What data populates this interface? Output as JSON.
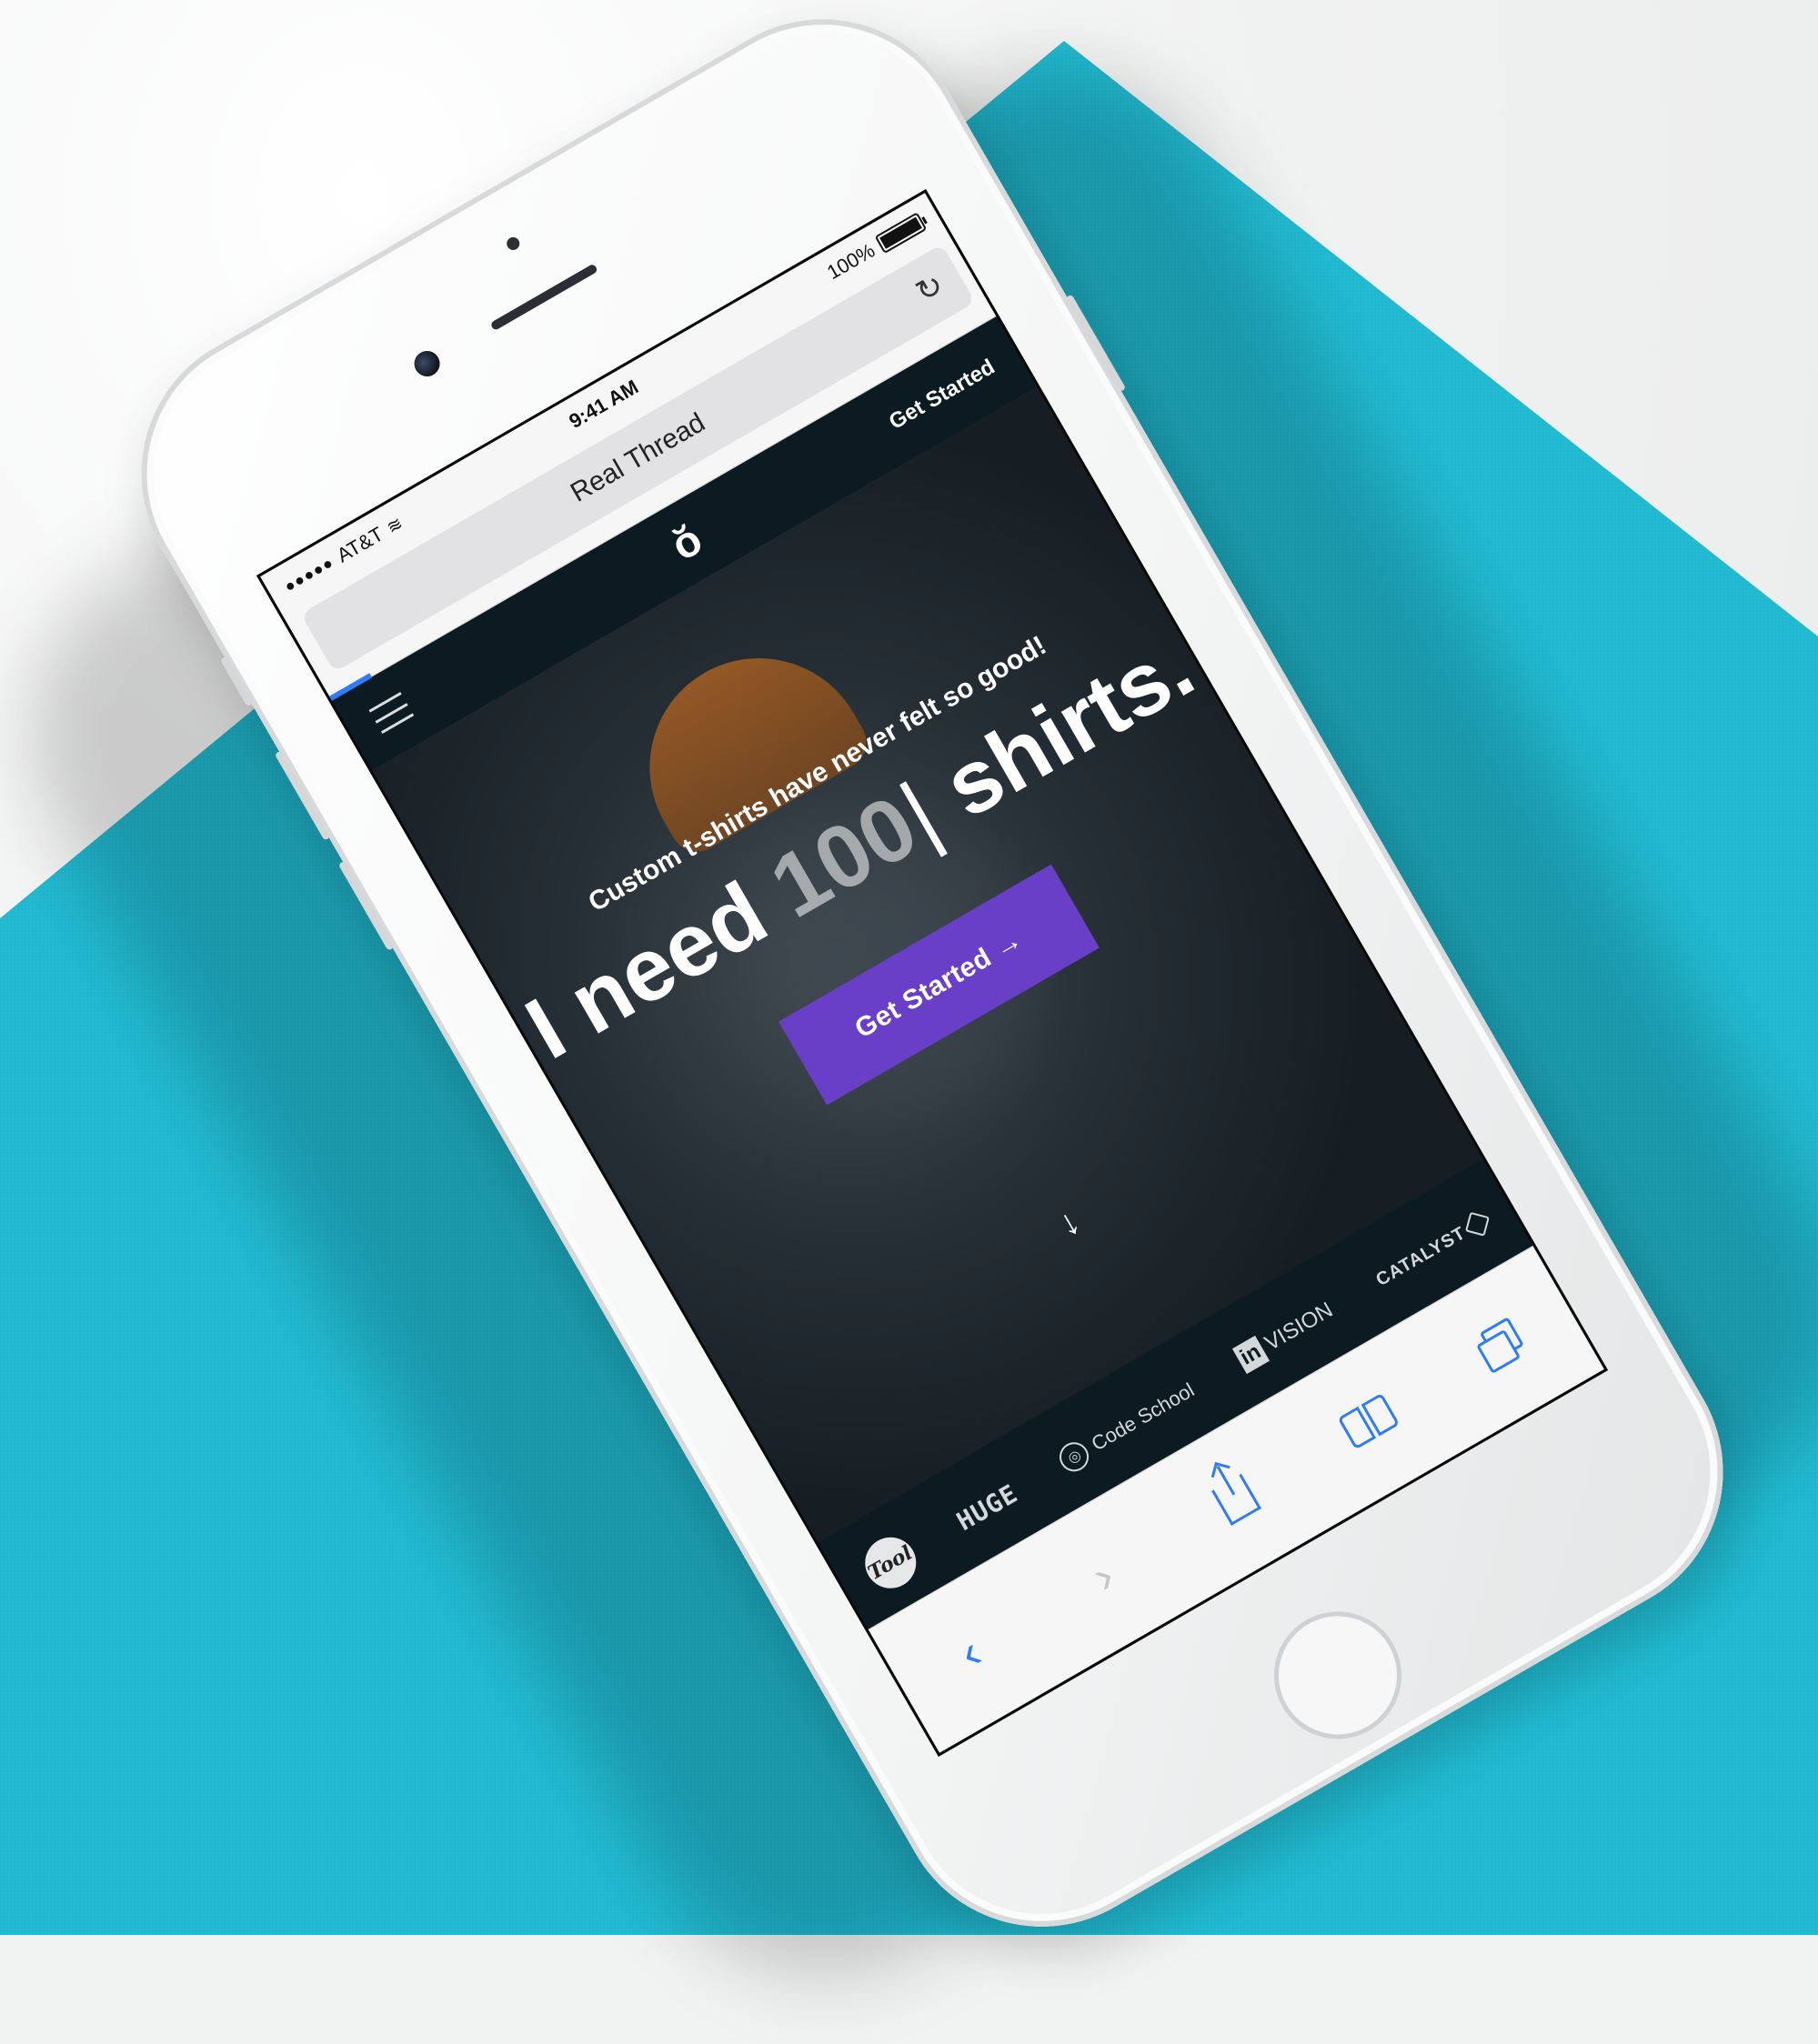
{
  "status_bar": {
    "carrier": "AT&T",
    "time": "9:41 AM",
    "battery": "100%"
  },
  "browser": {
    "page_title": "Real Thread",
    "load_progress": 0.06,
    "accent_color": "#2f7cf6"
  },
  "site": {
    "nav_cta": "Get Started",
    "logo": "ŏ",
    "tagline": "Custom t-shirts have never felt so good!",
    "heading_prefix": "I need",
    "heading_count": "100",
    "heading_suffix": "shirts.",
    "cta_label": "Get Started →",
    "cta_color": "#6a3fc8",
    "scroll_arrow": "↓",
    "client_logos": [
      "Tool",
      "HUGE",
      "Code School",
      "in",
      "VISION",
      "CATALYST"
    ]
  },
  "toolbar": {
    "back_icon": "‹",
    "forward_icon": "›"
  },
  "background": {
    "panel_color": "#1fb9d0"
  }
}
